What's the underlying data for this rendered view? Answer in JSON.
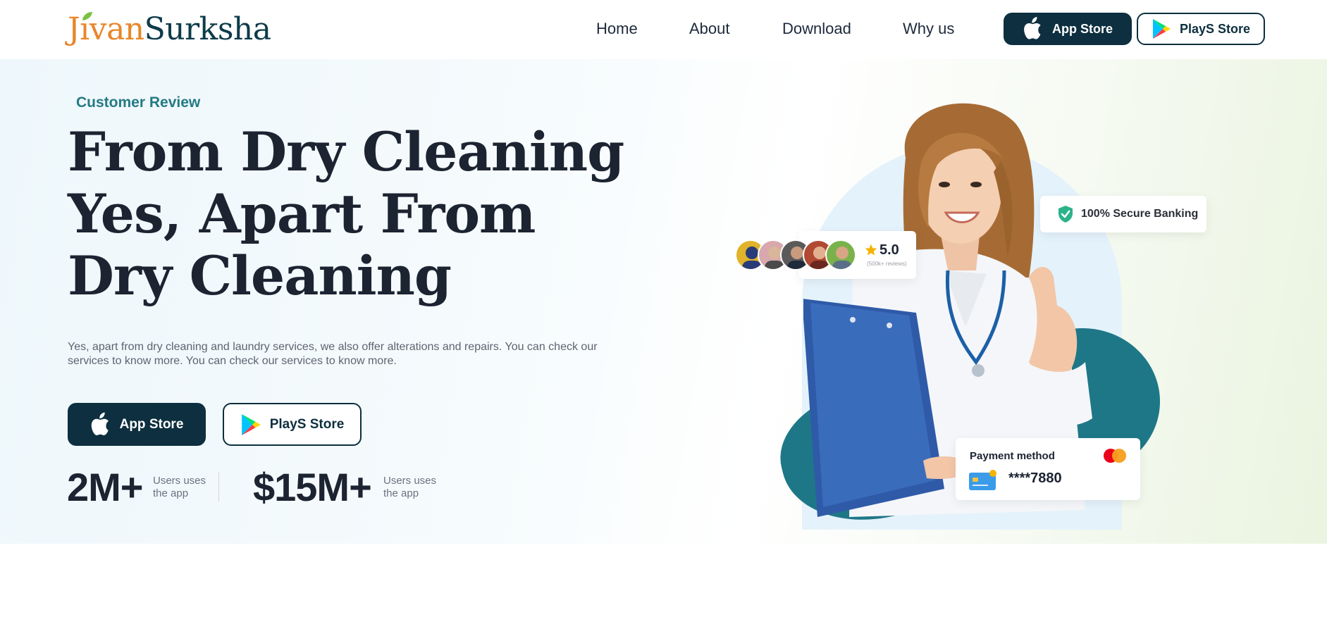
{
  "header": {
    "logo_part1": "Jivan",
    "logo_part2": "Surksha",
    "nav": [
      "Home",
      "About",
      "Download",
      "Why us"
    ],
    "app_store_label": "App Store",
    "play_store_label": "PlayS Store"
  },
  "hero": {
    "eyebrow": "Customer Review",
    "headline": "From Dry Cleaning Yes, Apart From Dry Cleaning",
    "description": "Yes, apart from dry cleaning and laundry services, we also offer alterations and repairs. You can check our services to know more. You can check our services to know more.",
    "app_store_label": "App Store",
    "play_store_label": "PlayS Store",
    "stats": [
      {
        "value": "2M+",
        "caption": "Users uses the app"
      },
      {
        "value": "$15M+",
        "caption": "Users uses the app"
      }
    ]
  },
  "cards": {
    "rating_value": "5.0",
    "rating_sub": "(500k+ reviews)",
    "secure_label": "100% Secure Banking",
    "payment_title": "Payment method",
    "payment_number": "****7880"
  },
  "colors": {
    "brand_dark": "#0d2f3f",
    "brand_teal": "#1e7787",
    "logo_orange": "#e8862a",
    "eyebrow_teal": "#247a84"
  },
  "icons": [
    "leaf-icon",
    "apple-icon",
    "play-store-icon",
    "star-icon",
    "shield-check-icon",
    "mastercard-icon",
    "credit-card-icon"
  ]
}
